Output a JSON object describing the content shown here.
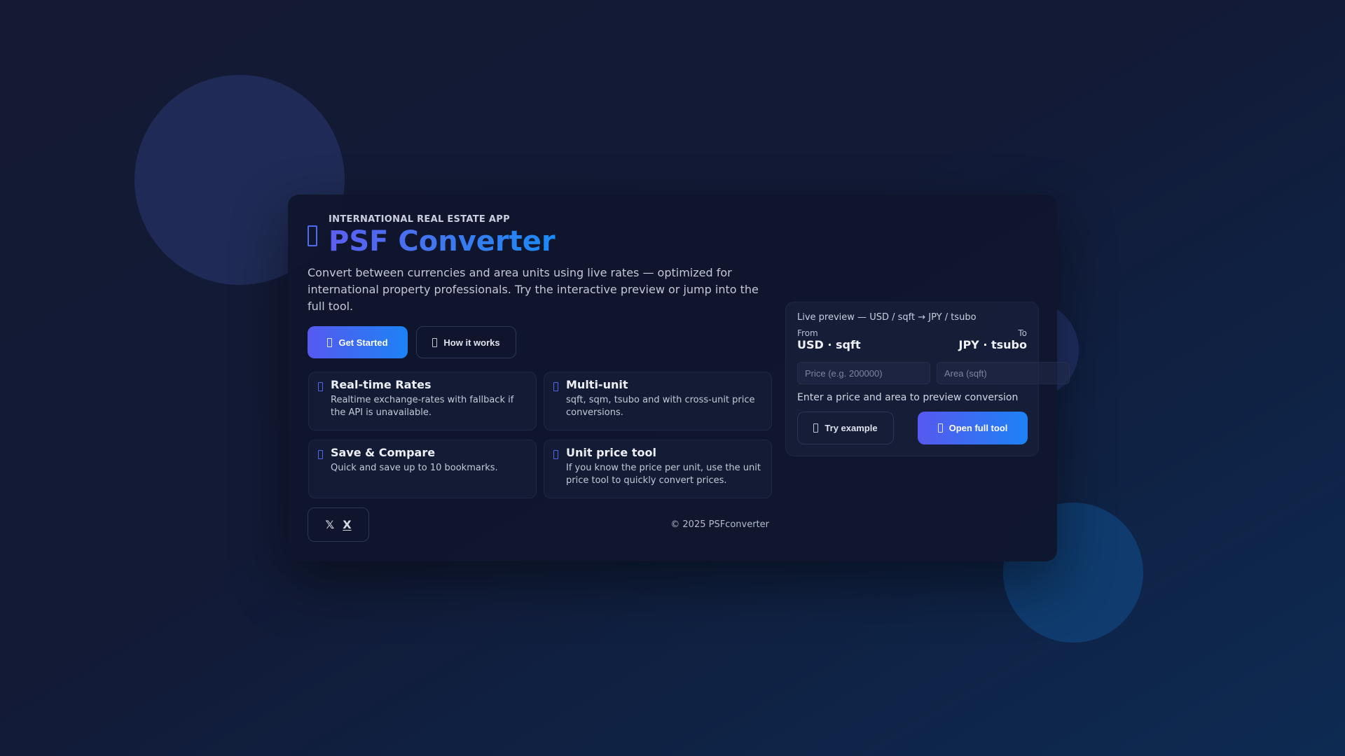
{
  "hero": {
    "eyebrow": "INTERNATIONAL REAL ESTATE APP",
    "title": "PSF Converter",
    "description": "Convert between currencies and area units using live rates — optimized for international property professionals. Try the interactive preview or jump into the full tool."
  },
  "actions": {
    "get_started": "Get Started",
    "how_it_works": "How it works"
  },
  "features": [
    {
      "title": "Real-time Rates",
      "text": "Realtime exchange-rates with fallback if the API is unavailable."
    },
    {
      "title": "Multi-unit",
      "text": "sqft, sqm, tsubo and with cross-unit price conversions."
    },
    {
      "title": "Save & Compare",
      "text": "Quick and save up to 10 bookmarks."
    },
    {
      "title": "Unit price tool",
      "text": "If you know the price per unit, use the unit price tool to quickly convert prices."
    }
  ],
  "footer": {
    "social": [
      "𝕏",
      "X"
    ],
    "copyright": "© 2025 PSFconverter"
  },
  "preview": {
    "title": "Live preview — USD / sqft → JPY / tsubo",
    "from_label": "From",
    "from_value": "USD · sqft",
    "to_label": "To",
    "to_value": "JPY · tsubo",
    "price_placeholder": "Price (e.g. 200000)",
    "area_placeholder": "Area (sqft)",
    "hint": "Enter a price and area to preview conversion",
    "try_example": "Try example",
    "open_full_tool": "Open full tool"
  },
  "colors": {
    "accent_start": "#5659f0",
    "accent_end": "#1d82f5",
    "background": "#121a36",
    "card": "#10162c"
  },
  "icons": {
    "hero": "app-icon",
    "get_started": "rocket-icon",
    "how_it_works": "info-icon",
    "try_example": "play-icon",
    "open_full_tool": "external-link-icon",
    "features": [
      "bolt-icon",
      "ruler-icon",
      "bookmark-icon",
      "calculator-icon"
    ]
  }
}
